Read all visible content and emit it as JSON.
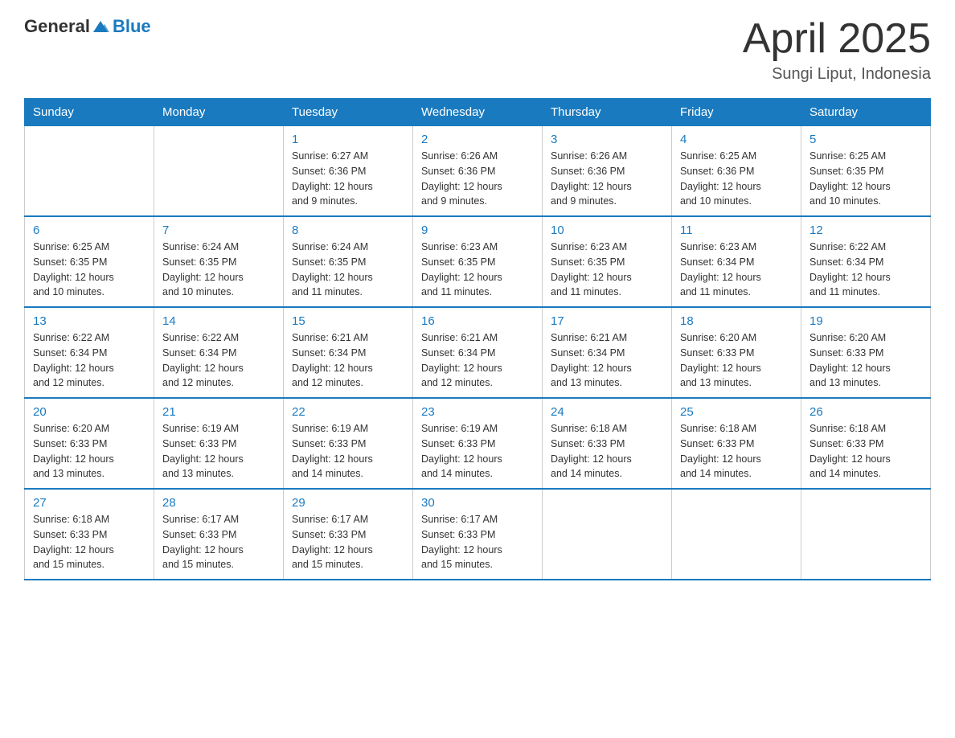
{
  "logo": {
    "general": "General",
    "blue": "Blue"
  },
  "title": "April 2025",
  "subtitle": "Sungi Liput, Indonesia",
  "weekdays": [
    "Sunday",
    "Monday",
    "Tuesday",
    "Wednesday",
    "Thursday",
    "Friday",
    "Saturday"
  ],
  "weeks": [
    [
      {
        "day": "",
        "info": ""
      },
      {
        "day": "",
        "info": ""
      },
      {
        "day": "1",
        "info": "Sunrise: 6:27 AM\nSunset: 6:36 PM\nDaylight: 12 hours\nand 9 minutes."
      },
      {
        "day": "2",
        "info": "Sunrise: 6:26 AM\nSunset: 6:36 PM\nDaylight: 12 hours\nand 9 minutes."
      },
      {
        "day": "3",
        "info": "Sunrise: 6:26 AM\nSunset: 6:36 PM\nDaylight: 12 hours\nand 9 minutes."
      },
      {
        "day": "4",
        "info": "Sunrise: 6:25 AM\nSunset: 6:36 PM\nDaylight: 12 hours\nand 10 minutes."
      },
      {
        "day": "5",
        "info": "Sunrise: 6:25 AM\nSunset: 6:35 PM\nDaylight: 12 hours\nand 10 minutes."
      }
    ],
    [
      {
        "day": "6",
        "info": "Sunrise: 6:25 AM\nSunset: 6:35 PM\nDaylight: 12 hours\nand 10 minutes."
      },
      {
        "day": "7",
        "info": "Sunrise: 6:24 AM\nSunset: 6:35 PM\nDaylight: 12 hours\nand 10 minutes."
      },
      {
        "day": "8",
        "info": "Sunrise: 6:24 AM\nSunset: 6:35 PM\nDaylight: 12 hours\nand 11 minutes."
      },
      {
        "day": "9",
        "info": "Sunrise: 6:23 AM\nSunset: 6:35 PM\nDaylight: 12 hours\nand 11 minutes."
      },
      {
        "day": "10",
        "info": "Sunrise: 6:23 AM\nSunset: 6:35 PM\nDaylight: 12 hours\nand 11 minutes."
      },
      {
        "day": "11",
        "info": "Sunrise: 6:23 AM\nSunset: 6:34 PM\nDaylight: 12 hours\nand 11 minutes."
      },
      {
        "day": "12",
        "info": "Sunrise: 6:22 AM\nSunset: 6:34 PM\nDaylight: 12 hours\nand 11 minutes."
      }
    ],
    [
      {
        "day": "13",
        "info": "Sunrise: 6:22 AM\nSunset: 6:34 PM\nDaylight: 12 hours\nand 12 minutes."
      },
      {
        "day": "14",
        "info": "Sunrise: 6:22 AM\nSunset: 6:34 PM\nDaylight: 12 hours\nand 12 minutes."
      },
      {
        "day": "15",
        "info": "Sunrise: 6:21 AM\nSunset: 6:34 PM\nDaylight: 12 hours\nand 12 minutes."
      },
      {
        "day": "16",
        "info": "Sunrise: 6:21 AM\nSunset: 6:34 PM\nDaylight: 12 hours\nand 12 minutes."
      },
      {
        "day": "17",
        "info": "Sunrise: 6:21 AM\nSunset: 6:34 PM\nDaylight: 12 hours\nand 13 minutes."
      },
      {
        "day": "18",
        "info": "Sunrise: 6:20 AM\nSunset: 6:33 PM\nDaylight: 12 hours\nand 13 minutes."
      },
      {
        "day": "19",
        "info": "Sunrise: 6:20 AM\nSunset: 6:33 PM\nDaylight: 12 hours\nand 13 minutes."
      }
    ],
    [
      {
        "day": "20",
        "info": "Sunrise: 6:20 AM\nSunset: 6:33 PM\nDaylight: 12 hours\nand 13 minutes."
      },
      {
        "day": "21",
        "info": "Sunrise: 6:19 AM\nSunset: 6:33 PM\nDaylight: 12 hours\nand 13 minutes."
      },
      {
        "day": "22",
        "info": "Sunrise: 6:19 AM\nSunset: 6:33 PM\nDaylight: 12 hours\nand 14 minutes."
      },
      {
        "day": "23",
        "info": "Sunrise: 6:19 AM\nSunset: 6:33 PM\nDaylight: 12 hours\nand 14 minutes."
      },
      {
        "day": "24",
        "info": "Sunrise: 6:18 AM\nSunset: 6:33 PM\nDaylight: 12 hours\nand 14 minutes."
      },
      {
        "day": "25",
        "info": "Sunrise: 6:18 AM\nSunset: 6:33 PM\nDaylight: 12 hours\nand 14 minutes."
      },
      {
        "day": "26",
        "info": "Sunrise: 6:18 AM\nSunset: 6:33 PM\nDaylight: 12 hours\nand 14 minutes."
      }
    ],
    [
      {
        "day": "27",
        "info": "Sunrise: 6:18 AM\nSunset: 6:33 PM\nDaylight: 12 hours\nand 15 minutes."
      },
      {
        "day": "28",
        "info": "Sunrise: 6:17 AM\nSunset: 6:33 PM\nDaylight: 12 hours\nand 15 minutes."
      },
      {
        "day": "29",
        "info": "Sunrise: 6:17 AM\nSunset: 6:33 PM\nDaylight: 12 hours\nand 15 minutes."
      },
      {
        "day": "30",
        "info": "Sunrise: 6:17 AM\nSunset: 6:33 PM\nDaylight: 12 hours\nand 15 minutes."
      },
      {
        "day": "",
        "info": ""
      },
      {
        "day": "",
        "info": ""
      },
      {
        "day": "",
        "info": ""
      }
    ]
  ]
}
